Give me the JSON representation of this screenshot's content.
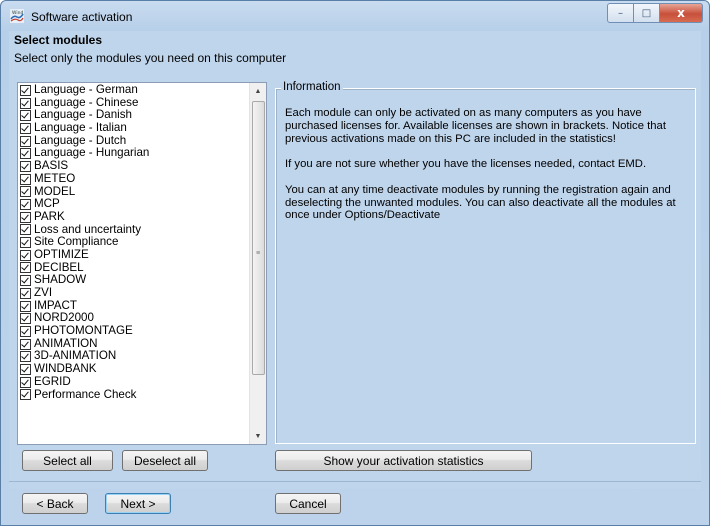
{
  "window": {
    "title": "Software activation",
    "controls": {
      "minimize": "–",
      "maximize": "□",
      "close": "x"
    }
  },
  "page": {
    "heading": "Select modules",
    "subheading": "Select only the modules you need on this computer"
  },
  "modules": [
    {
      "label": "Language - German",
      "checked": true
    },
    {
      "label": "Language - Chinese",
      "checked": true
    },
    {
      "label": "Language - Danish",
      "checked": true
    },
    {
      "label": "Language - Italian",
      "checked": true
    },
    {
      "label": "Language - Dutch",
      "checked": true
    },
    {
      "label": "Language - Hungarian",
      "checked": true
    },
    {
      "label": "BASIS",
      "checked": true
    },
    {
      "label": "METEO",
      "checked": true
    },
    {
      "label": "MODEL",
      "checked": true
    },
    {
      "label": "MCP",
      "checked": true
    },
    {
      "label": "PARK",
      "checked": true
    },
    {
      "label": "Loss and uncertainty",
      "checked": true
    },
    {
      "label": "Site Compliance",
      "checked": true
    },
    {
      "label": "OPTIMIZE",
      "checked": true
    },
    {
      "label": "DECIBEL",
      "checked": true
    },
    {
      "label": "SHADOW",
      "checked": true
    },
    {
      "label": "ZVI",
      "checked": true
    },
    {
      "label": "IMPACT",
      "checked": true
    },
    {
      "label": "NORD2000",
      "checked": true
    },
    {
      "label": "PHOTOMONTAGE",
      "checked": true
    },
    {
      "label": "ANIMATION",
      "checked": true
    },
    {
      "label": "3D-ANIMATION",
      "checked": true
    },
    {
      "label": "WINDBANK",
      "checked": true
    },
    {
      "label": "EGRID",
      "checked": true
    },
    {
      "label": "Performance Check",
      "checked": true
    }
  ],
  "information": {
    "legend": "Information",
    "paragraphs": [
      "Each module can only be activated on as many computers as you have purchased licenses for.  Available licenses are shown in brackets. Notice that previous activations made on this PC are included in the statistics!",
      "If you are not sure whether you have the licenses needed, contact EMD.",
      "You can at any time deactivate modules by running the registration again and deselecting the unwanted modules. You can also deactivate all the modules at once under Options/Deactivate"
    ]
  },
  "buttons": {
    "select_all": "Select all",
    "deselect_all": "Deselect all",
    "show_stats": "Show your activation statistics",
    "back": "< Back",
    "next": "Next >",
    "cancel": "Cancel"
  }
}
